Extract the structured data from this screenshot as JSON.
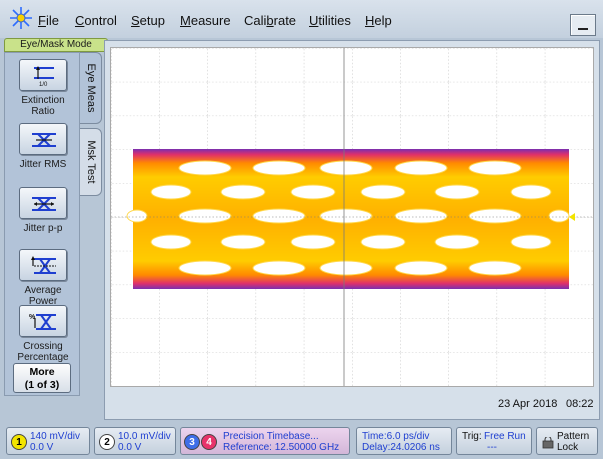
{
  "menu": {
    "items": [
      {
        "id": "file",
        "before": "",
        "u": "F",
        "after": "ile"
      },
      {
        "id": "control",
        "before": "",
        "u": "C",
        "after": "ontrol"
      },
      {
        "id": "setup",
        "before": "",
        "u": "S",
        "after": "etup"
      },
      {
        "id": "measure",
        "before": "",
        "u": "M",
        "after": "easure"
      },
      {
        "id": "calibrate",
        "before": "Cali",
        "u": "b",
        "after": "rate"
      },
      {
        "id": "utilities",
        "before": "",
        "u": "U",
        "after": "tilities"
      },
      {
        "id": "help",
        "before": "",
        "u": "H",
        "after": "elp"
      }
    ]
  },
  "mode_tab": "Eye/Mask Mode",
  "side_tabs": {
    "eye_meas": "Eye Meas",
    "msk_test": "Msk Test"
  },
  "measurements": [
    {
      "id": "extinction-ratio",
      "label_line1": "Extinction",
      "label_line2": "Ratio",
      "icon_text": "1/0"
    },
    {
      "id": "jitter-rms",
      "label_line1": "Jitter RMS",
      "label_line2": ""
    },
    {
      "id": "jitter-pp",
      "label_line1": "Jitter p-p",
      "label_line2": ""
    },
    {
      "id": "average-power",
      "label_line1": "Average",
      "label_line2": "Power"
    },
    {
      "id": "crossing-percentage",
      "label_line1": "Crossing",
      "label_line2": "Percentage",
      "icon_text": "%"
    }
  ],
  "more_button": {
    "line1": "More",
    "line2": "(1 of 3)"
  },
  "timestamp": {
    "date": "23 Apr 2018",
    "time": "08:22"
  },
  "status": {
    "ch1": {
      "num": "1",
      "line1": "140 mV/div",
      "line2": "0.0 V",
      "color": "#f2e400"
    },
    "ch2": {
      "num": "2",
      "line1": "10.0 mV/div",
      "line2": "0.0 V",
      "color": "#ffffff"
    },
    "ch3": {
      "num": "3",
      "color": "#3f6ee8"
    },
    "ch4": {
      "num": "4",
      "color": "#e8336b"
    },
    "timebase": {
      "line1": "Precision Timebase...",
      "line2": "Reference: 12.50000 GHz"
    },
    "time": {
      "line1": "Time:6.0 ps/div",
      "line2": "Delay:24.0206 ns"
    },
    "trig": {
      "label": "Trig:",
      "value": "Free Run",
      "dash": "---"
    },
    "pattern": {
      "line1": "Pattern",
      "line2": "Lock"
    }
  },
  "colors": {
    "eye_core": "#ffcc00",
    "eye_mid": "#ff8a00",
    "eye_edge": "#e0306a",
    "eye_noise": "#7a2fb0",
    "accent_blue": "#1f3fd0"
  }
}
